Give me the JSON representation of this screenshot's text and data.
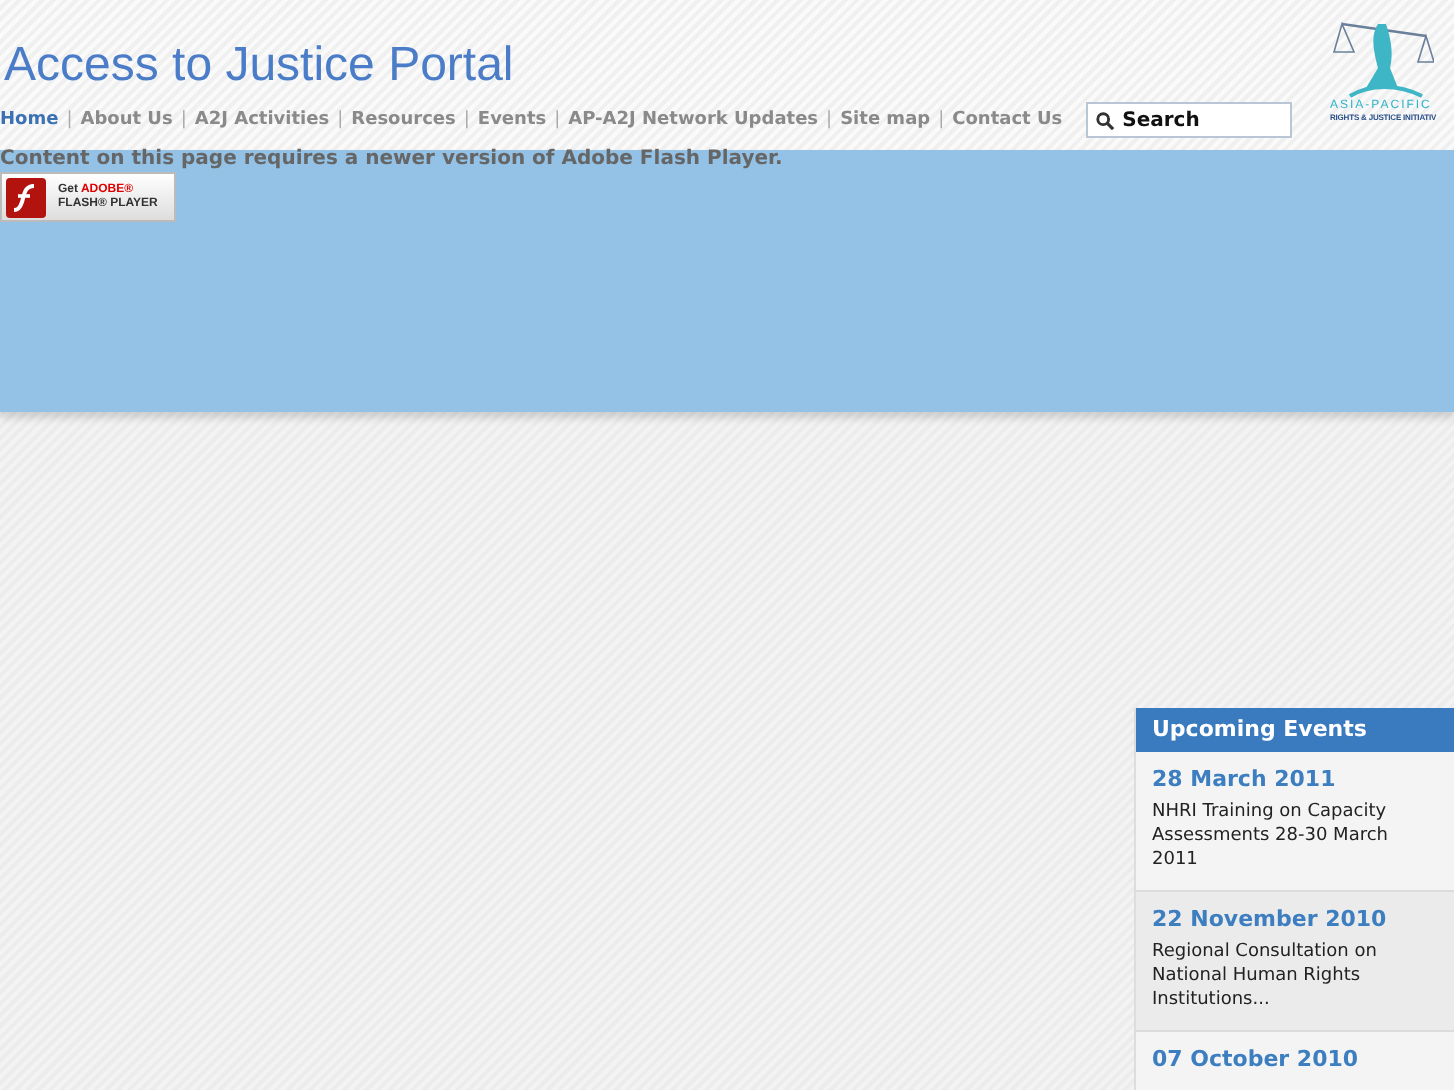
{
  "header": {
    "title": "Access to Justice Portal",
    "logo": {
      "line_1": "ASIA-PACIFIC",
      "line_2": "RIGHTS & JUSTICE INITIATIV"
    }
  },
  "nav": [
    {
      "label": "Home",
      "selected": true
    },
    {
      "label": "About Us",
      "selected": false
    },
    {
      "label": "A2J Activities",
      "selected": false
    },
    {
      "label": "Resources",
      "selected": false
    },
    {
      "label": "Events",
      "selected": false
    },
    {
      "label": "AP-A2J Network Updates",
      "selected": false
    },
    {
      "label": "Site map",
      "selected": false
    },
    {
      "label": "Contact Us",
      "selected": false
    }
  ],
  "nav_separator": "|",
  "search": {
    "placeholder": "Search"
  },
  "flash": {
    "message": "Content on this page requires a newer version of Adobe Flash Player.",
    "badge_line_1": "Get",
    "badge_brand": "ADOBE®",
    "badge_line_2": "FLASH® PLAYER"
  },
  "events": {
    "title": "Upcoming Events",
    "items": [
      {
        "date": "28 March 2011",
        "text": "NHRI Training on Capacity Assessments 28-30 March 2011"
      },
      {
        "date": "22 November 2010",
        "text": "Regional Consultation on National Human Rights Institutions..."
      },
      {
        "date": "07 October 2010"
      }
    ]
  }
}
